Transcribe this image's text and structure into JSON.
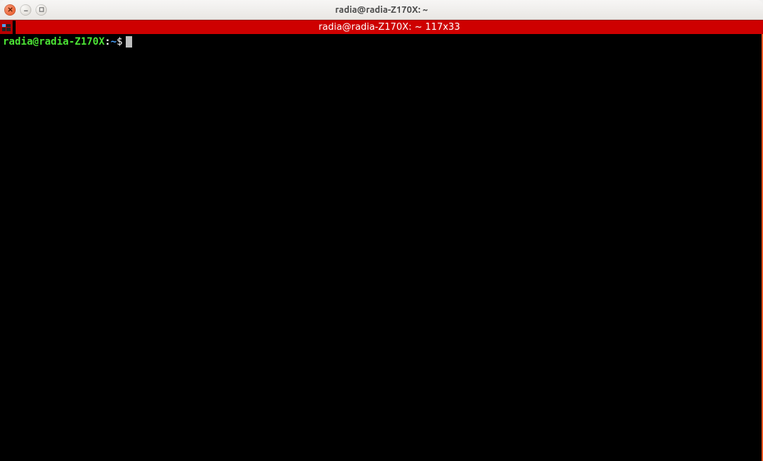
{
  "window": {
    "title": "radia@radia-Z170X: ~"
  },
  "tabbar": {
    "label": "radia@radia-Z170X: ~ 117x33"
  },
  "prompt": {
    "user_host": "radia@radia-Z170X",
    "separator": ":",
    "cwd": "~",
    "symbol": "$"
  }
}
